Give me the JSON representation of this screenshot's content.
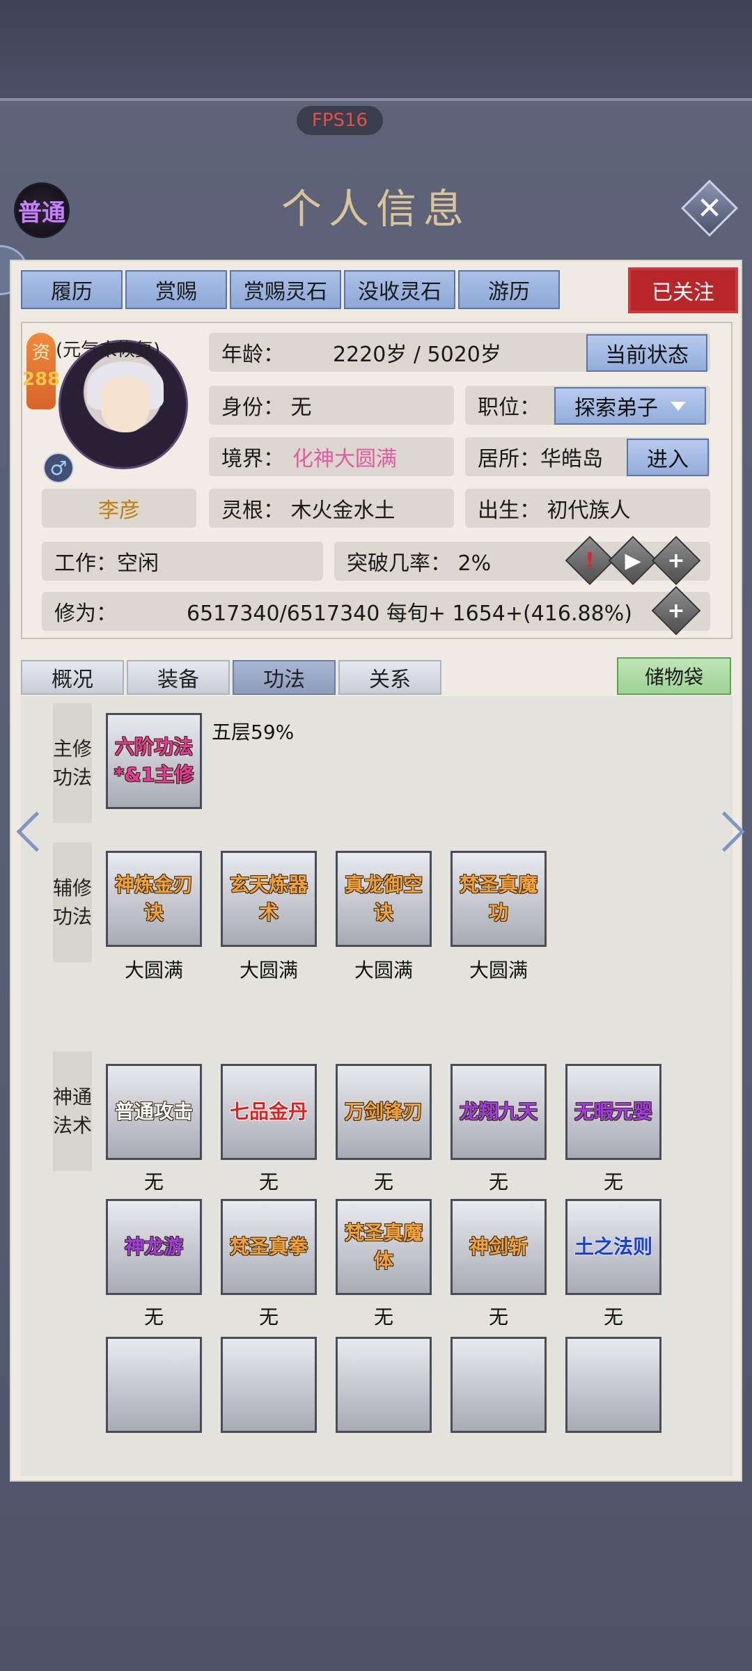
{
  "fps": "FPS16",
  "grade": "普通",
  "title": "个人信息",
  "top_tabs": [
    "履历",
    "赏赐",
    "赏赐灵石",
    "没收灵石",
    "游历"
  ],
  "follow_label": "已关注",
  "profile": {
    "talent_label": "资",
    "talent_value": "288",
    "recovery": "(元气未恢复)",
    "name": "李彦",
    "gender": "♂",
    "age_label": "年龄：",
    "age_value": "2220岁 / 5020岁",
    "status_btn": "当前状态",
    "identity": "身份：  无",
    "position_label": "职位：",
    "position_value": "探索弟子",
    "realm_label": "境界：",
    "realm_value": "化神大圆满",
    "residence": "居所：华皓岛",
    "enter_btn": "进入",
    "root": "灵根：  木火金水土",
    "birth": "出生：  初代族人",
    "work": "工作：空闲",
    "breakthrough": "突破几率：  2%",
    "cultivation_label": "修为：",
    "cultivation_value": "6517340/6517340  每旬+  1654+(416.88%)"
  },
  "mid_tabs": [
    "概况",
    "装备",
    "功法",
    "关系"
  ],
  "bag_label": "储物袋",
  "sections": {
    "main": "主修功法",
    "aux": "辅修功法",
    "magic": "神通法术"
  },
  "main_skill": {
    "name": "六阶功法*&1主修",
    "level": "五层59%"
  },
  "aux_skills": [
    {
      "name": "神炼金刃诀",
      "status": "大圆满"
    },
    {
      "name": "玄天炼器术",
      "status": "大圆满"
    },
    {
      "name": "真龙御空诀",
      "status": "大圆满"
    },
    {
      "name": "梵圣真魔功",
      "status": "大圆满"
    }
  ],
  "magic_row1": [
    {
      "name": "普通攻击",
      "status": "无"
    },
    {
      "name": "七品金丹",
      "status": "无"
    },
    {
      "name": "万剑锋刃",
      "status": "无"
    },
    {
      "name": "龙翔九天",
      "status": "无"
    },
    {
      "name": "无暇元婴",
      "status": "无"
    }
  ],
  "magic_row2": [
    {
      "name": "神龙游",
      "status": "无"
    },
    {
      "name": "梵圣真拳",
      "status": "无"
    },
    {
      "name": "梵圣真魔体",
      "status": "无"
    },
    {
      "name": "神剑斩",
      "status": "无"
    },
    {
      "name": "土之法则",
      "status": "无"
    }
  ],
  "colors": {
    "accent": "#8ea8d6",
    "follow": "#b8262a",
    "realm": "#e25aa0",
    "name": "#c27d10"
  }
}
